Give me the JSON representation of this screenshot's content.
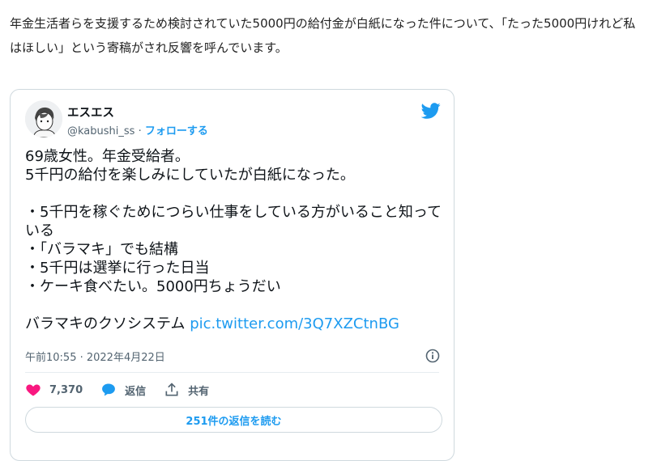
{
  "article": {
    "text": "年金生活者らを支援するため検討されていた5000円の給付金が白紙になった件について、「たった5000円けれど私はほしい」という寄稿がされ反響を呼んでいます。"
  },
  "tweet": {
    "display_name": "エスエス",
    "handle": "@kabushi_ss",
    "separator": "·",
    "follow_label": "フォローする",
    "body": "69歳女性。年金受給者。\n5千円の給付を楽しみにしていたが白紙になった。\n\n・5千円を稼ぐためにつらい仕事をしている方がいること知っている\n・「バラマキ」でも結構\n・5千円は選挙に行った日当\n・ケーキ食べたい。5000円ちょうだい\n\nバラマキのクソシステム ",
    "link": "pic.twitter.com/3Q7XZCtnBG",
    "timestamp": "午前10:55 · 2022年4月22日",
    "likes": "7,370",
    "reply_label": "返信",
    "share_label": "共有",
    "replies_button": "251件の返信を読む"
  },
  "colors": {
    "accent": "#1d9bf0",
    "heart": "#f91880",
    "muted": "#536471"
  }
}
